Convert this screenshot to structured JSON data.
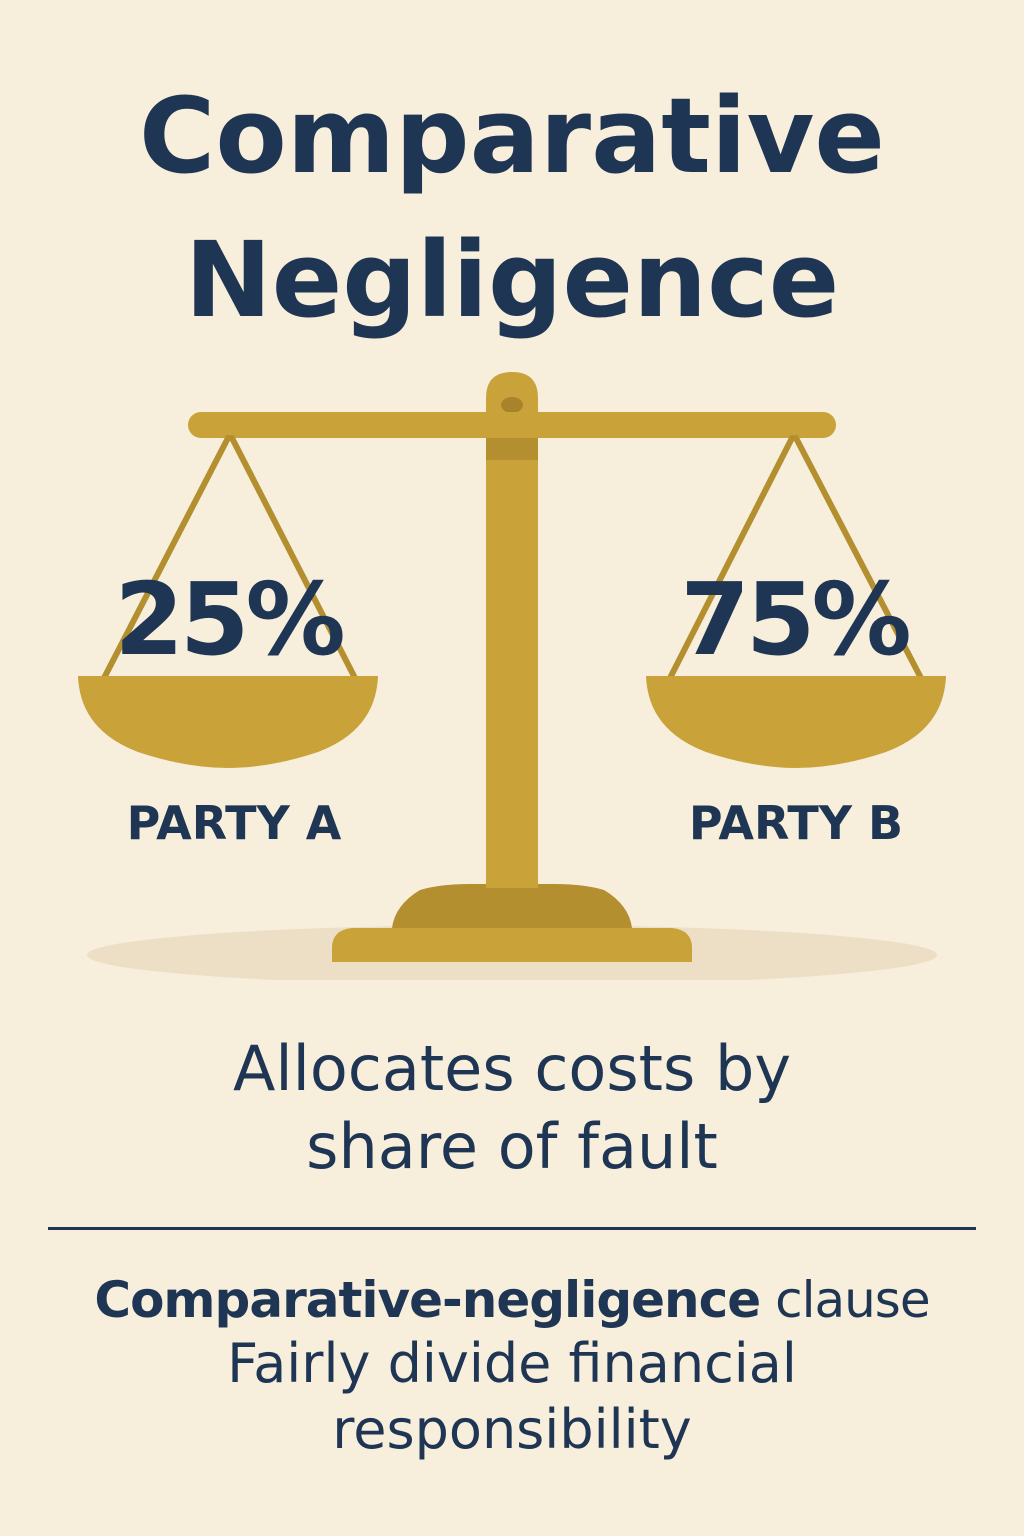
{
  "title": {
    "line1": "Comparative",
    "line2": "Negligence"
  },
  "scale": {
    "left_percent": "25%",
    "right_percent": "75%",
    "left_label": "PARTY A",
    "right_label": "PARTY B",
    "color": "#c9a23a"
  },
  "tagline": {
    "line1": "Allocates costs by",
    "line2": "share of fault"
  },
  "footer": {
    "bold_part": "Comparative-negligence",
    "normal_part": " clause",
    "line2": "Fairly divide financial",
    "line3": "responsibility"
  },
  "colors": {
    "background": "#f8eedc",
    "text": "#1e3553",
    "gold": "#c9a23a",
    "gold_dark": "#a9832a"
  }
}
